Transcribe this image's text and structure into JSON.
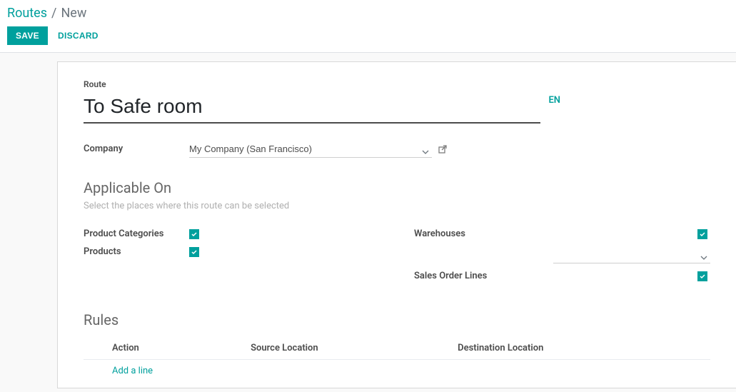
{
  "breadcrumb": {
    "root": "Routes",
    "sep": "/",
    "leaf": "New"
  },
  "actions": {
    "save_label": "SAVE",
    "discard_label": "DISCARD"
  },
  "route": {
    "small_label": "Route",
    "name": "To Safe room",
    "lang": "EN"
  },
  "company": {
    "label": "Company",
    "value": "My Company (San Francisco)"
  },
  "applicable": {
    "title": "Applicable On",
    "subtitle": "Select the places where this route can be selected",
    "product_categories_label": "Product Categories",
    "products_label": "Products",
    "warehouses_label": "Warehouses",
    "warehouse_value": "",
    "sales_order_lines_label": "Sales Order Lines"
  },
  "rules": {
    "title": "Rules",
    "col_action": "Action",
    "col_source": "Source Location",
    "col_dest": "Destination Location",
    "add_line": "Add a line"
  }
}
